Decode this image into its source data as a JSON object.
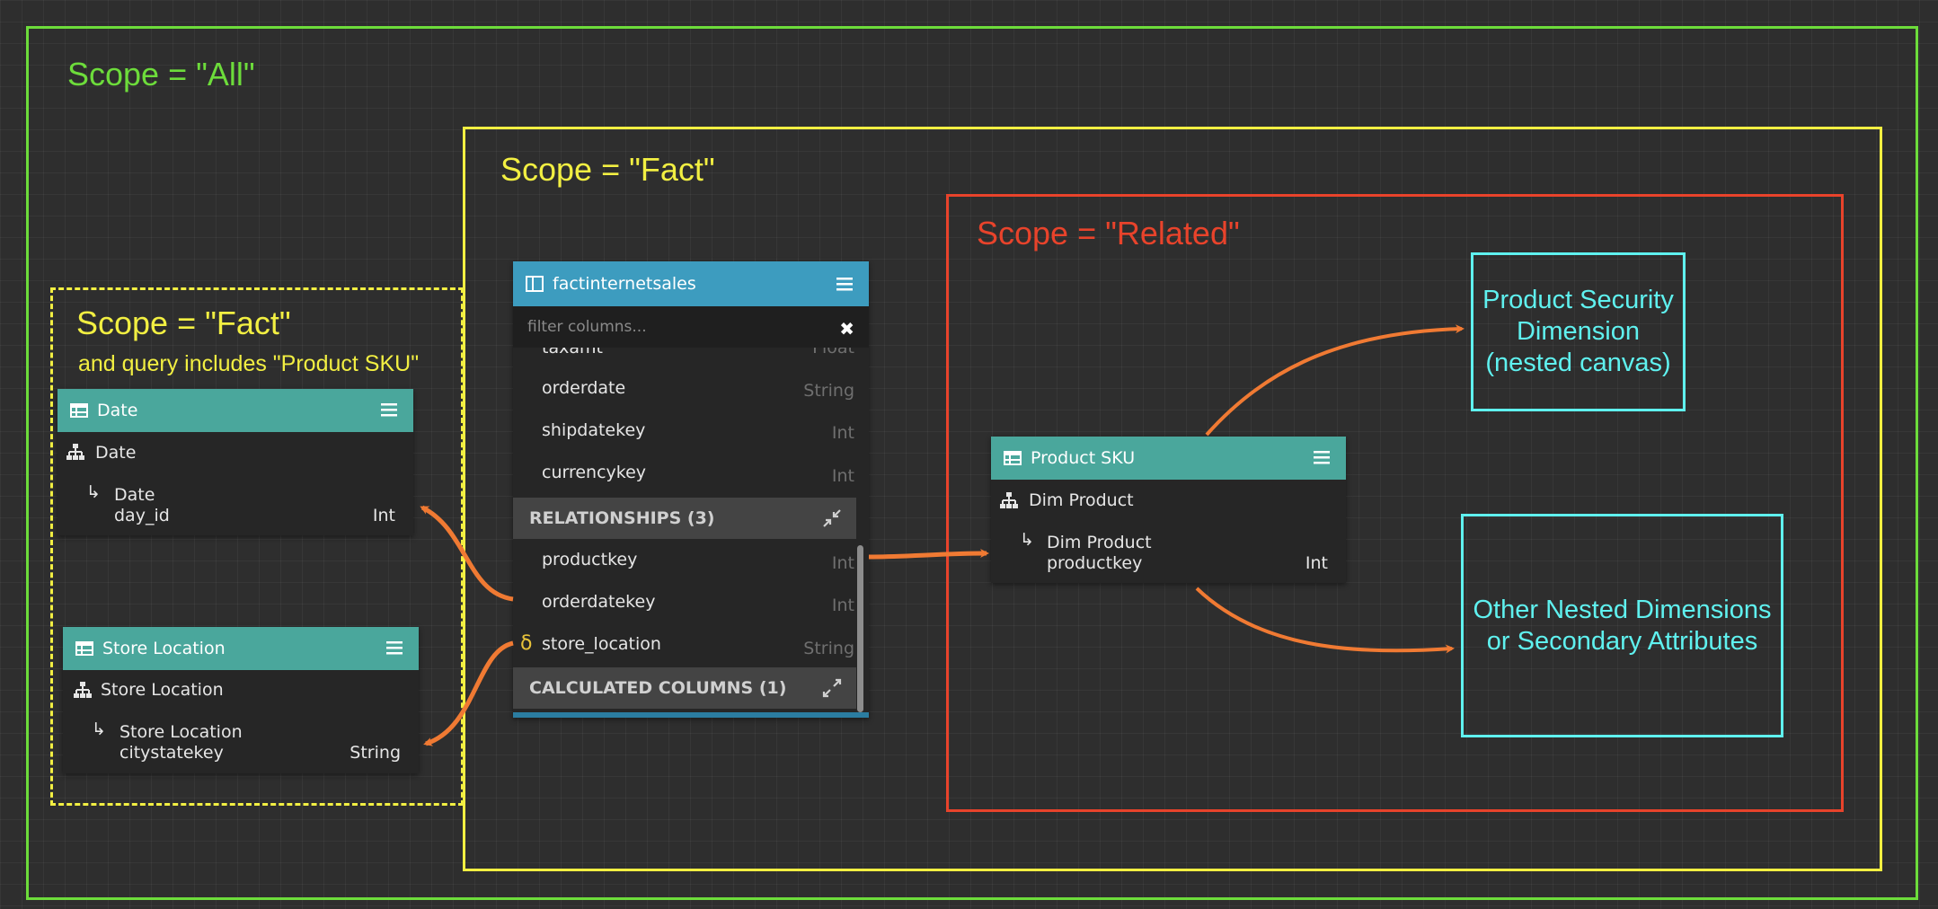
{
  "scopes": {
    "all": {
      "label": "Scope = \"All\"",
      "color": "#6ddc3b"
    },
    "fact": {
      "label": "Scope = \"Fact\"",
      "color": "#f2ef42"
    },
    "related": {
      "label": "Scope = \"Related\"",
      "color": "#e8432b"
    },
    "fact_query": {
      "label": "Scope = \"Fact\"",
      "sublabel": "and query includes \"Product SKU\"",
      "color": "#f2ef42"
    }
  },
  "date_card": {
    "title": "Date",
    "hierarchy": "Date",
    "level": "Date",
    "column": "day_id",
    "type": "Int"
  },
  "store_card": {
    "title": "Store Location",
    "hierarchy": "Store Location",
    "level": "Store Location",
    "column": "citystatekey",
    "type": "String"
  },
  "fact_table": {
    "title": "factinternetsales",
    "filter_placeholder": "filter columns...",
    "partial_row": {
      "name": "taxamt",
      "type": "Float"
    },
    "columns": [
      {
        "name": "orderdate",
        "type": "String"
      },
      {
        "name": "shipdatekey",
        "type": "Int"
      },
      {
        "name": "currencykey",
        "type": "Int"
      }
    ],
    "relationships_label": "RELATIONSHIPS (3)",
    "relationships": [
      {
        "name": "productkey",
        "type": "Int"
      },
      {
        "name": "orderdatekey",
        "type": "Int"
      },
      {
        "name": "store_location",
        "type": "String",
        "marker": "δ"
      }
    ],
    "calculated_label": "CALCULATED COLUMNS (1)"
  },
  "product_card": {
    "title": "Product SKU",
    "hierarchy": "Dim Product",
    "level": "Dim Product",
    "column": "productkey",
    "type": "Int"
  },
  "nested_boxes": {
    "security": {
      "line1": "Product Security",
      "line2": "Dimension",
      "line3": "(nested canvas)"
    },
    "other": {
      "line1": "Other Nested Dimensions",
      "line2": "or Secondary Attributes"
    }
  },
  "colors": {
    "canvas": "#2e2e2e",
    "dimension_header": "#4aa79c",
    "fact_header": "#3d9cbf",
    "arrow": "#f07a33",
    "nested_box": "#5ff1ef",
    "delta_marker": "#e7c23a"
  },
  "icons": [
    "table-icon",
    "menu-icon",
    "hierarchy-icon",
    "level-arrow-icon",
    "clear-icon",
    "collapse-icon",
    "expand-icon"
  ]
}
